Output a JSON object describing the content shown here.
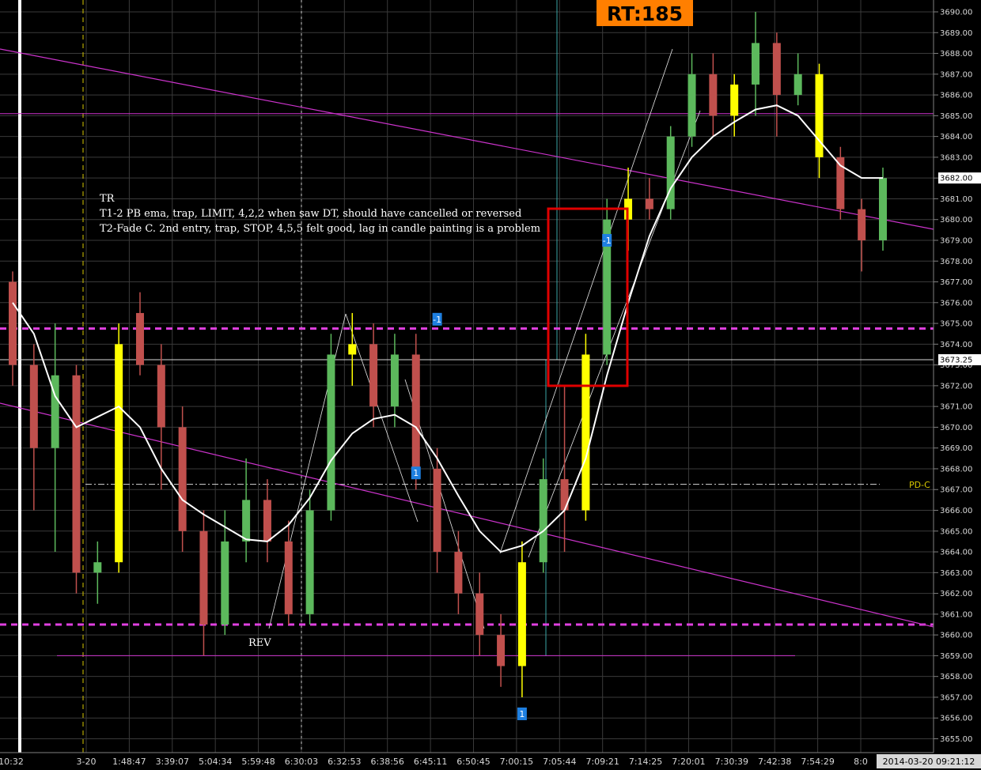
{
  "colors": {
    "background": "#000000",
    "bull_candle": "#5cb85c",
    "bear_candle": "#c0504d",
    "signal_bar": "#ffff00",
    "ema": "#ffffff",
    "trendline": "#cc33cc",
    "dashed_level": "#e040e0",
    "rt_badge_bg": "#ff7f00",
    "rt_badge_text": "#000000",
    "highlight_box": "#e00000",
    "marker": "#1e7fe0",
    "pdc": "#d8c800"
  },
  "header": {
    "rt_badge": "RT:185"
  },
  "notes": {
    "title": "TR",
    "lines": [
      "T1-2 PB ema, trap, LIMIT, 4,2,2 when saw DT, should have cancelled or reversed",
      "T2-Fade C. 2nd entry, trap, STOP, 4,5,5 felt good, lag in candle painting is a problem"
    ]
  },
  "annotations": {
    "rev": "REV",
    "pdc": "PD-C"
  },
  "markers": [
    {
      "label": "-1",
      "x_index": 20,
      "price": 3675.2
    },
    {
      "label": "1",
      "x_index": 19,
      "price": 3667.8
    },
    {
      "label": "1",
      "x_index": 24,
      "price": 3656.2
    },
    {
      "label": "-1",
      "x_index": 28,
      "price": 3679.0
    }
  ],
  "axis": {
    "price_labels": [
      "3690.00",
      "3689.00",
      "3688.00",
      "3687.00",
      "3686.00",
      "3685.00",
      "3684.00",
      "3683.00",
      "3682.00",
      "3681.00",
      "3680.00",
      "3679.00",
      "3678.00",
      "3677.00",
      "3676.00",
      "3675.00",
      "3674.00",
      "3673.00",
      "3672.00",
      "3671.00",
      "3670.00",
      "3669.00",
      "3668.00",
      "3667.00",
      "3666.00",
      "3665.00",
      "3664.00",
      "3663.00",
      "3662.00",
      "3661.00",
      "3660.00",
      "3659.00",
      "3658.00",
      "3657.00",
      "3656.00",
      "3655.00"
    ],
    "current_price": "3682.00",
    "crosshair_price": "3673.25",
    "time_labels": [
      "10:32",
      "3-20",
      "1:48:47",
      "3:39:07",
      "5:04:34",
      "5:59:48",
      "6:30:03",
      "6:32:53",
      "6:38:56",
      "6:45:11",
      "6:50:45",
      "7:00:15",
      "7:05:44",
      "7:09:21",
      "7:14:25",
      "7:20:01",
      "7:30:39",
      "7:42:38",
      "7:54:29",
      "8:0"
    ],
    "datetime": "2014-03-20   09:21:12"
  },
  "chart_data": {
    "type": "candlestick",
    "title": "",
    "ylim": [
      3654.6,
      3690.4
    ],
    "levels": {
      "pd_close": 3667.25,
      "dashed_upper": 3674.75,
      "dashed_lower": 3660.5,
      "crosshair": 3673.25,
      "bottom_line": 3659.0,
      "horizontal_top": 3685.1
    },
    "candles": [
      {
        "o": 3677.0,
        "h": 3677.5,
        "l": 3672.0,
        "c": 3673.0
      },
      {
        "o": 3673.0,
        "h": 3674.0,
        "l": 3666.0,
        "c": 3669.0
      },
      {
        "o": 3669.0,
        "h": 3675.0,
        "l": 3664.0,
        "c": 3672.5
      },
      {
        "o": 3672.5,
        "h": 3673.0,
        "l": 3662.0,
        "c": 3663.0
      },
      {
        "o": 3663.0,
        "h": 3664.5,
        "l": 3661.5,
        "c": 3663.5
      },
      {
        "o": 3663.5,
        "h": 3675.0,
        "l": 3663.0,
        "c": 3674.0
      },
      {
        "o": 3675.5,
        "h": 3676.5,
        "l": 3672.5,
        "c": 3673.0
      },
      {
        "o": 3673.0,
        "h": 3674.0,
        "l": 3667.0,
        "c": 3670.0
      },
      {
        "o": 3670.0,
        "h": 3671.0,
        "l": 3664.0,
        "c": 3665.0
      },
      {
        "o": 3665.0,
        "h": 3666.0,
        "l": 3659.0,
        "c": 3660.5
      },
      {
        "o": 3660.5,
        "h": 3666.0,
        "l": 3660.0,
        "c": 3664.5
      },
      {
        "o": 3664.5,
        "h": 3668.5,
        "l": 3663.5,
        "c": 3666.5
      },
      {
        "o": 3666.5,
        "h": 3667.5,
        "l": 3663.5,
        "c": 3664.5
      },
      {
        "o": 3664.5,
        "h": 3665.5,
        "l": 3660.5,
        "c": 3661.0
      },
      {
        "o": 3661.0,
        "h": 3667.0,
        "l": 3660.5,
        "c": 3666.0
      },
      {
        "o": 3666.0,
        "h": 3674.5,
        "l": 3665.5,
        "c": 3673.5
      },
      {
        "o": 3673.5,
        "h": 3675.5,
        "l": 3672.0,
        "c": 3674.0
      },
      {
        "o": 3674.0,
        "h": 3675.0,
        "l": 3670.0,
        "c": 3671.0
      },
      {
        "o": 3671.0,
        "h": 3674.5,
        "l": 3670.0,
        "c": 3673.5
      },
      {
        "o": 3673.5,
        "h": 3674.5,
        "l": 3667.0,
        "c": 3668.0
      },
      {
        "o": 3668.0,
        "h": 3669.0,
        "l": 3663.0,
        "c": 3664.0
      },
      {
        "o": 3664.0,
        "h": 3665.0,
        "l": 3661.0,
        "c": 3662.0
      },
      {
        "o": 3662.0,
        "h": 3663.0,
        "l": 3659.0,
        "c": 3660.0
      },
      {
        "o": 3660.0,
        "h": 3661.0,
        "l": 3657.5,
        "c": 3658.5
      },
      {
        "o": 3658.5,
        "h": 3664.5,
        "l": 3657.0,
        "c": 3663.5
      },
      {
        "o": 3663.5,
        "h": 3668.5,
        "l": 3663.0,
        "c": 3667.5
      },
      {
        "o": 3667.5,
        "h": 3672.0,
        "l": 3664.0,
        "c": 3666.0
      },
      {
        "o": 3666.0,
        "h": 3674.5,
        "l": 3665.5,
        "c": 3673.5
      },
      {
        "o": 3673.5,
        "h": 3681.0,
        "l": 3673.0,
        "c": 3680.0
      },
      {
        "o": 3680.0,
        "h": 3682.5,
        "l": 3678.5,
        "c": 3681.0
      },
      {
        "o": 3681.0,
        "h": 3682.0,
        "l": 3680.0,
        "c": 3680.5
      },
      {
        "o": 3680.5,
        "h": 3684.5,
        "l": 3680.0,
        "c": 3684.0
      },
      {
        "o": 3684.0,
        "h": 3688.0,
        "l": 3683.5,
        "c": 3687.0
      },
      {
        "o": 3687.0,
        "h": 3688.0,
        "l": 3684.0,
        "c": 3685.0
      },
      {
        "o": 3685.0,
        "h": 3687.0,
        "l": 3684.0,
        "c": 3686.5
      },
      {
        "o": 3686.5,
        "h": 3690.0,
        "l": 3685.0,
        "c": 3688.5
      },
      {
        "o": 3688.5,
        "h": 3689.0,
        "l": 3684.0,
        "c": 3686.0
      },
      {
        "o": 3686.0,
        "h": 3688.0,
        "l": 3685.5,
        "c": 3687.0
      },
      {
        "o": 3687.0,
        "h": 3687.5,
        "l": 3682.0,
        "c": 3683.0
      },
      {
        "o": 3683.0,
        "h": 3683.5,
        "l": 3680.0,
        "c": 3680.5
      },
      {
        "o": 3680.5,
        "h": 3681.0,
        "l": 3677.5,
        "c": 3679.0
      },
      {
        "o": 3679.0,
        "h": 3682.5,
        "l": 3678.5,
        "c": 3682.0
      }
    ],
    "signal_bars": [
      5,
      16,
      24,
      27,
      29,
      34,
      38
    ],
    "ema": [
      3676.0,
      3674.5,
      3671.5,
      3670.0,
      3670.5,
      3671.0,
      3670.0,
      3668.0,
      3666.5,
      3665.8,
      3665.2,
      3664.6,
      3664.5,
      3665.3,
      3666.6,
      3668.4,
      3669.7,
      3670.4,
      3670.6,
      3670.0,
      3668.5,
      3666.7,
      3665.0,
      3664.0,
      3664.3,
      3665.0,
      3666.0,
      3668.5,
      3672.5,
      3676.0,
      3679.2,
      3681.5,
      3683.0,
      3684.0,
      3684.7,
      3685.3,
      3685.5,
      3685.0,
      3683.8,
      3682.6,
      3682.0,
      3682.0
    ]
  }
}
